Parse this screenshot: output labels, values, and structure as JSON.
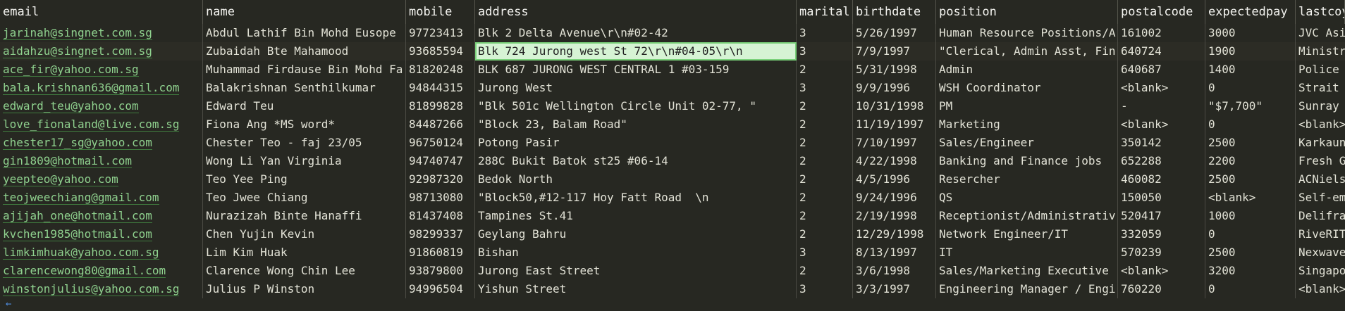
{
  "columns": [
    "email",
    "name",
    "mobile",
    "address",
    "marital",
    "birthdate",
    "position",
    "postalcode",
    "expectedpay",
    "lastcoy"
  ],
  "rows": [
    [
      "jarinah@singnet.com.sg",
      "Abdul Lathif Bin Mohd Eusope",
      "97723413",
      "Blk 2 Delta Avenue\\r\\n#02-42",
      "3",
      "5/26/1997",
      "Human Resource Positions/A",
      "161002",
      "3000",
      "JVC Asia"
    ],
    [
      "aidahzu@singnet.com.sg",
      "Zubaidah Bte Mahamood",
      "93685594",
      "Blk 724 Jurong west St 72\\r\\n#04-05\\r\\n",
      "3",
      "7/9/1997",
      "\"Clerical, Admin Asst, Fin",
      "640724",
      "1900",
      "Ministry"
    ],
    [
      "ace_fir@yahoo.com.sg",
      "Muhammad Firdause Bin Mohd Fa",
      "81820248",
      "BLK 687 JURONG WEST CENTRAL 1 #03-159",
      "2",
      "5/31/1998",
      "Admin",
      "640687",
      "1400",
      "Police C"
    ],
    [
      "bala.krishnan636@gmail.com",
      "Balakrishnan Senthilkumar",
      "94844315",
      "Jurong West",
      "3",
      "9/9/1996",
      "WSH Coordinator",
      "<blank>",
      "0",
      "Strait R"
    ],
    [
      "edward_teu@yahoo.com",
      "Edward Teu",
      "81899828",
      "\"Blk 501c Wellington Circle Unit 02-77, \"",
      "2",
      "10/31/1998",
      "PM",
      "-",
      "\"$7,700\"",
      "Sunray W"
    ],
    [
      "love_fionaland@live.com.sg",
      "Fiona Ang *MS word*",
      "84487266",
      "\"Block 23, Balam Road\"",
      "2",
      "11/19/1997",
      "Marketing",
      "<blank>",
      "0",
      "<blank>"
    ],
    [
      "chester17_sg@yahoo.com",
      "Chester Teo - faj 23/05",
      "96750124",
      "Potong Pasir",
      "2",
      "7/10/1997",
      "Sales/Engineer",
      "350142",
      "2500",
      "Karkauns"
    ],
    [
      "gin1809@hotmail.com",
      "Wong Li Yan Virginia",
      "94740747",
      "288C Bukit Batok st25 #06-14",
      "2",
      "4/22/1998",
      "Banking and Finance jobs",
      "652288",
      "2200",
      "Fresh Gr"
    ],
    [
      "yeepteo@yahoo.com",
      "Teo Yee Ping",
      "92987320",
      "Bedok North",
      "2",
      "4/5/1996",
      "Resercher",
      "460082",
      "2500",
      "ACNielse"
    ],
    [
      "teojweechiang@gmail.com",
      "Teo Jwee Chiang",
      "98713080",
      "\"Block50,#12-117 Hoy Fatt Road  \\n",
      "2",
      "9/24/1996",
      "QS",
      "150050",
      "<blank>",
      "Self-emp"
    ],
    [
      "ajijah_one@hotmail.com",
      "Nurazizah Binte Hanaffi",
      "81437408",
      "Tampines St.41",
      "2",
      "2/19/1998",
      "Receptionist/Administrativ",
      "520417",
      "1000",
      "Delifran"
    ],
    [
      "kvchen1985@hotmail.com",
      "Chen Yujin Kevin",
      "98299337",
      "Geylang Bahru",
      "2",
      "12/29/1998",
      "Network Engineer/IT",
      "332059",
      "0",
      "RiveRIT"
    ],
    [
      "limkimhuak@yahoo.com.sg",
      "Lim Kim Huak",
      "91860819",
      "Bishan",
      "3",
      "8/13/1997",
      "IT",
      "570239",
      "2500",
      "Nexwave"
    ],
    [
      "clarencewong80@gmail.com",
      "Clarence Wong Chin Lee",
      "93879800",
      "Jurong East Street",
      "2",
      "3/6/1998",
      "Sales/Marketing Executive",
      "<blank>",
      "3200",
      "Singapor"
    ],
    [
      "winstonjulius@yahoo.com.sg",
      "Julius P Winston",
      "94996504",
      "Yishun Street",
      "3",
      "3/3/1997",
      "Engineering Manager / Engi",
      "760220",
      "0",
      "<blank>"
    ]
  ],
  "selected": {
    "row": 1,
    "col": 3
  },
  "footer_arrow": "←",
  "colors": {
    "background": "#272822",
    "link": "#8fd18e",
    "selected": "#d6f3d4"
  }
}
